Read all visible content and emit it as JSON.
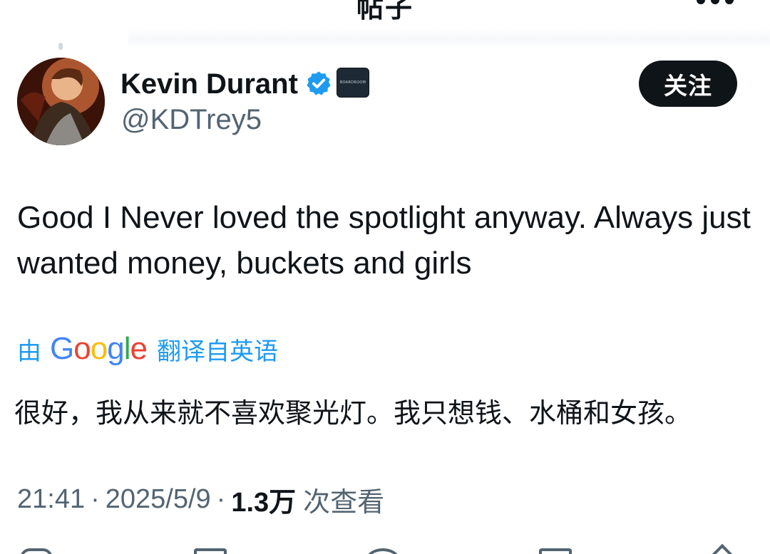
{
  "nav": {
    "title": "帖子",
    "back_icon": "arrow-left-icon",
    "more_icon": "more-horizontal-icon"
  },
  "author": {
    "name": "Kevin Durant",
    "handle": "@KDTrey5",
    "verified_icon": "verified-badge-icon",
    "verified_color": "#1d9bf0",
    "org_badge_text": "BOARDROOM",
    "follow_label": "关注"
  },
  "tweet": {
    "text": "Good I Never loved the spotlight anyway. Always just wanted money, buckets and girls"
  },
  "translation": {
    "by_label": "由",
    "provider": "Google",
    "from_label": "翻译自英语",
    "text": "很好，我从来就不喜欢聚光灯。我只想钱、水桶和女孩。"
  },
  "meta": {
    "time": "21:41",
    "separator": "·",
    "date": "2025/5/9",
    "views_count": "1.3万",
    "views_label": "次查看"
  },
  "colors": {
    "text_primary": "#0f1419",
    "text_secondary": "#536471",
    "accent": "#1d9bf0",
    "follow_bg": "#0f1419"
  }
}
